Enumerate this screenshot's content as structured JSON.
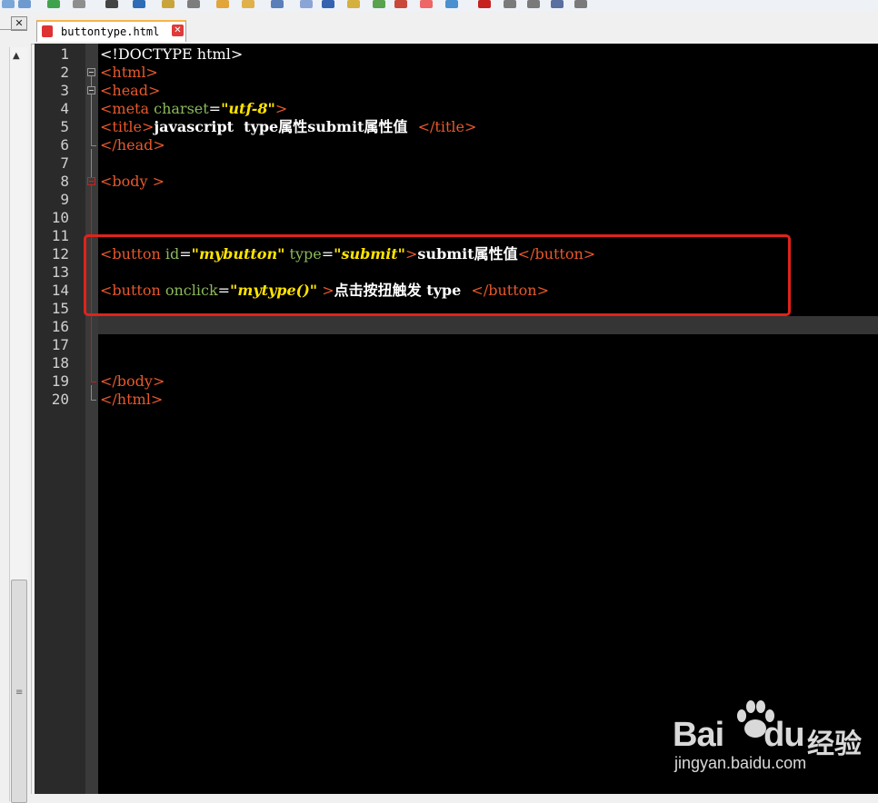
{
  "tab": {
    "filename": "buttontype.html",
    "close_glyph": "✕"
  },
  "left_panel": {
    "close_glyph": "✕",
    "arrow_glyph": "▲",
    "grip_glyph": "≡"
  },
  "line_numbers": [
    "1",
    "2",
    "3",
    "4",
    "5",
    "6",
    "7",
    "8",
    "9",
    "10",
    "11",
    "12",
    "13",
    "14",
    "15",
    "16",
    "17",
    "18",
    "19",
    "20"
  ],
  "code": {
    "l1": {
      "t": "<!DOCTYPE html>"
    },
    "l2": {
      "t": "<html>"
    },
    "l3": {
      "t": "<head>"
    },
    "l4": {
      "t1": "<meta ",
      "a1": "charset",
      "eq": "=",
      "s1": "\"utf-8\"",
      "t2": ">"
    },
    "l5": {
      "t1": "<title>",
      "txt": "javascript  type属性submit属性值  ",
      "t2": "</title>"
    },
    "l6": {
      "t": "</head>"
    },
    "l8": {
      "t": "<body >"
    },
    "l12": {
      "t1": "<button ",
      "a1": "id",
      "eq1": "=",
      "s1": "\"mybutton\"",
      "sp": " ",
      "a2": "type",
      "eq2": "=",
      "s2": "\"submit\"",
      "t2": ">",
      "txt": "submit属性值",
      "t3": "</button>"
    },
    "l14": {
      "t1": "<button ",
      "a1": "onclick",
      "eq1": "=",
      "s1": "\"mytype()\"",
      "t2": " >",
      "txt": "点击按扭触发 type  ",
      "t3": "</button>"
    },
    "l19": {
      "t": "</body>"
    },
    "l20": {
      "t": "</html>"
    }
  },
  "watermark": {
    "logo": "Bai",
    "logo2": "du",
    "cn": "经验",
    "url": "jingyan.baidu.com"
  },
  "colors": {
    "tag": "#e8592b",
    "attr": "#8bb95a",
    "string": "#ffe400",
    "highlight_box": "#e0231a"
  }
}
